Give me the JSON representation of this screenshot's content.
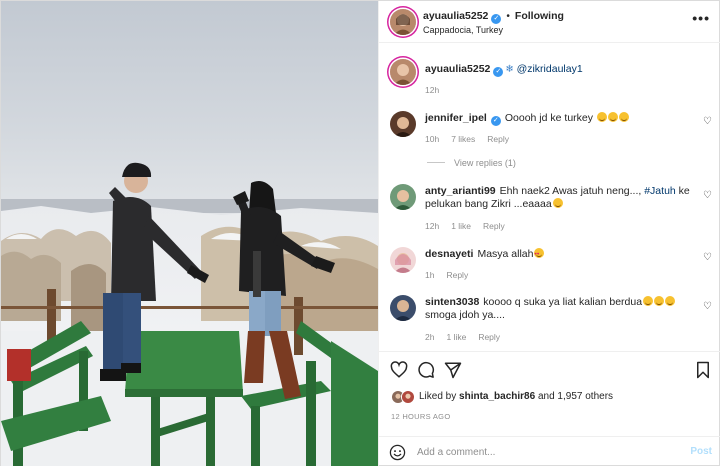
{
  "header": {
    "username": "ayuaulia5252",
    "separator": "•",
    "follow_status": "Following",
    "location": "Cappadocia, Turkey",
    "more_label": "•••"
  },
  "caption": {
    "username": "ayuaulia5252",
    "mention": "@zikridaulay1",
    "time": "12h"
  },
  "comments": [
    {
      "username": "jennifer_ipel",
      "verified": true,
      "text": "Ooooh jd ke turkey",
      "time": "10h",
      "likes": "7 likes",
      "reply": "Reply",
      "view_replies": "View replies (1)"
    },
    {
      "username": "anty_arianti99",
      "text_before": "Ehh naek2 Awas jatuh neng...,",
      "hashtag": "#Jatuh",
      "text_after": "ke pelukan bang Zikri ...eaaaa",
      "time": "12h",
      "likes": "1 like",
      "reply": "Reply"
    },
    {
      "username": "desnayeti",
      "text": "Masya allah",
      "time": "1h",
      "reply": "Reply"
    },
    {
      "username": "sinten3038",
      "text_before": "koooo q suka ya liat kalian berdua",
      "text_after": "smoga jdoh ya....",
      "time": "2h",
      "likes": "1 like",
      "reply": "Reply"
    }
  ],
  "actions": {
    "liked_by_prefix": "Liked by",
    "liked_by_user": "shinta_bachir86",
    "liked_by_suffix": "and 1,957 others",
    "post_time": "12 HOURS AGO"
  },
  "add_comment": {
    "placeholder": "Add a comment...",
    "post_label": "Post"
  },
  "colors": {
    "link": "#00376b",
    "verified": "#3897f0",
    "muted": "#8e8e8e",
    "post_disabled": "#b2dffc"
  }
}
